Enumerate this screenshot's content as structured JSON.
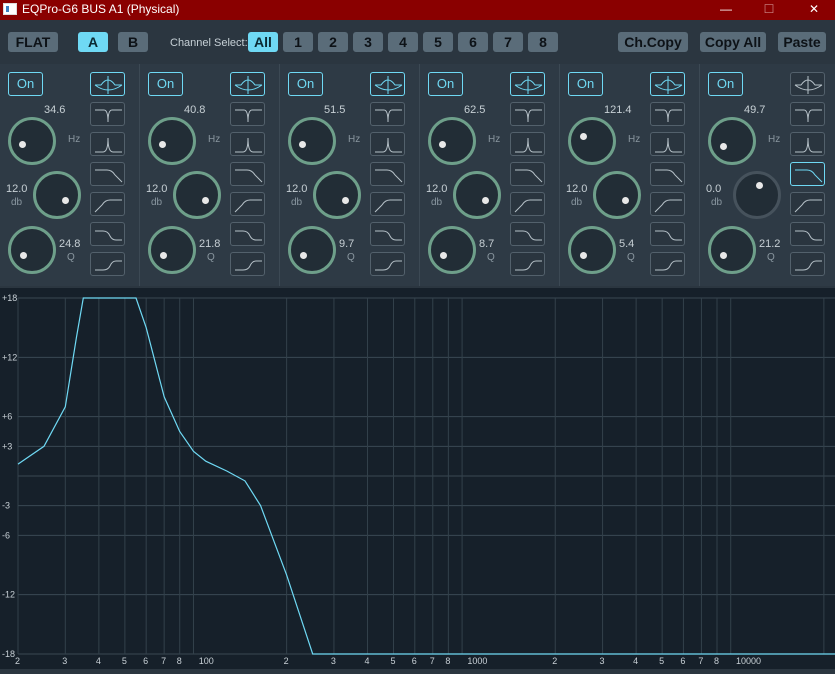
{
  "window": {
    "title": "EQPro-G6 BUS A1 (Physical)",
    "minimize": "—",
    "maximize": "☐",
    "close": "✕"
  },
  "toolbar": {
    "flat": "FLAT",
    "a": "A",
    "b": "B",
    "channel_select_label": "Channel Select:",
    "channels": [
      "All",
      "1",
      "2",
      "3",
      "4",
      "5",
      "6",
      "7",
      "8"
    ],
    "selected_channel": "All",
    "selected_preset": "A",
    "ch_copy": "Ch.Copy",
    "copy_all": "Copy All",
    "paste": "Paste"
  },
  "bands": [
    {
      "on": "On",
      "freq": "34.6",
      "freq_unit": "Hz",
      "gain": "12.0",
      "gain_unit": "db",
      "q": "24.8",
      "q_unit": "Q",
      "active": true,
      "selected_filter": "bell"
    },
    {
      "on": "On",
      "freq": "40.8",
      "freq_unit": "Hz",
      "gain": "12.0",
      "gain_unit": "db",
      "q": "21.8",
      "q_unit": "Q",
      "active": true,
      "selected_filter": "bell"
    },
    {
      "on": "On",
      "freq": "51.5",
      "freq_unit": "Hz",
      "gain": "12.0",
      "gain_unit": "db",
      "q": "9.7",
      "q_unit": "Q",
      "active": true,
      "selected_filter": "bell"
    },
    {
      "on": "On",
      "freq": "62.5",
      "freq_unit": "Hz",
      "gain": "12.0",
      "gain_unit": "db",
      "q": "8.7",
      "q_unit": "Q",
      "active": true,
      "selected_filter": "bell"
    },
    {
      "on": "On",
      "freq": "121.4",
      "freq_unit": "Hz",
      "gain": "12.0",
      "gain_unit": "db",
      "q": "5.4",
      "q_unit": "Q",
      "active": true,
      "selected_filter": "bell"
    },
    {
      "on": "On",
      "freq": "49.7",
      "freq_unit": "Hz",
      "gain": "0.0",
      "gain_unit": "db",
      "q": "21.2",
      "q_unit": "Q",
      "active": false,
      "selected_filter": "low-pass"
    }
  ],
  "filter_types": [
    "bell",
    "notch",
    "peak",
    "low-pass",
    "high-pass",
    "low-shelf",
    "high-shelf"
  ],
  "graph": {
    "y_labels": [
      "+18",
      "+12",
      "+6",
      "+3",
      "-3",
      "-6",
      "-12",
      "-18"
    ],
    "x_labels": [
      "2",
      "3",
      "4",
      "5",
      "6",
      "7",
      "8",
      "100",
      "2",
      "3",
      "4",
      "5",
      "6",
      "7",
      "8",
      "1000",
      "2",
      "3",
      "4",
      "5",
      "6",
      "7",
      "8",
      "10000"
    ],
    "curve_color": "#6fd9f4"
  },
  "colors": {
    "accent": "#6fd9f4",
    "knob_ring": "#6e9f8a",
    "titlebar": "#8a0000"
  }
}
